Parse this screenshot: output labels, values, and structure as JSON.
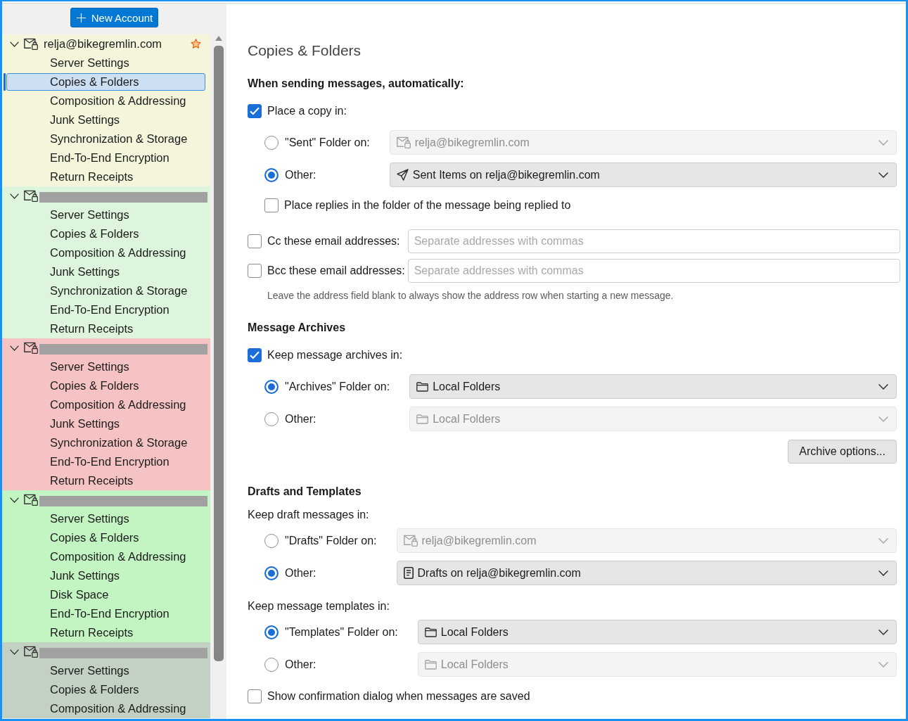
{
  "sidebar": {
    "new_account_button": {
      "label": "New Account"
    },
    "accounts": [
      {
        "name": "relja@bikegremlin.com",
        "redacted": false,
        "default": true,
        "expanded": true,
        "color": "#f5f5dc",
        "children": [
          {
            "label": "Server Settings",
            "selected": false
          },
          {
            "label": "Copies & Folders",
            "selected": true
          },
          {
            "label": "Composition & Addressing",
            "selected": false
          },
          {
            "label": "Junk Settings",
            "selected": false
          },
          {
            "label": "Synchronization & Storage",
            "selected": false
          },
          {
            "label": "End-To-End Encryption",
            "selected": false
          },
          {
            "label": "Return Receipts",
            "selected": false
          }
        ]
      },
      {
        "redacted": true,
        "default": false,
        "expanded": true,
        "color": "#dcf5dc",
        "children": [
          {
            "label": "Server Settings",
            "selected": false
          },
          {
            "label": "Copies & Folders",
            "selected": false
          },
          {
            "label": "Composition & Addressing",
            "selected": false
          },
          {
            "label": "Junk Settings",
            "selected": false
          },
          {
            "label": "Synchronization & Storage",
            "selected": false
          },
          {
            "label": "End-To-End Encryption",
            "selected": false
          },
          {
            "label": "Return Receipts",
            "selected": false
          }
        ]
      },
      {
        "redacted": true,
        "default": false,
        "expanded": true,
        "color": "#f5c3c3",
        "children": [
          {
            "label": "Server Settings",
            "selected": false
          },
          {
            "label": "Copies & Folders",
            "selected": false
          },
          {
            "label": "Composition & Addressing",
            "selected": false
          },
          {
            "label": "Junk Settings",
            "selected": false
          },
          {
            "label": "Synchronization & Storage",
            "selected": false
          },
          {
            "label": "End-To-End Encryption",
            "selected": false
          },
          {
            "label": "Return Receipts",
            "selected": false
          }
        ]
      },
      {
        "redacted": true,
        "default": false,
        "expanded": true,
        "color": "#c3f5c3",
        "children": [
          {
            "label": "Server Settings",
            "selected": false
          },
          {
            "label": "Copies & Folders",
            "selected": false
          },
          {
            "label": "Composition & Addressing",
            "selected": false
          },
          {
            "label": "Junk Settings",
            "selected": false
          },
          {
            "label": "Disk Space",
            "selected": false
          },
          {
            "label": "End-To-End Encryption",
            "selected": false
          },
          {
            "label": "Return Receipts",
            "selected": false
          }
        ]
      },
      {
        "redacted": true,
        "default": false,
        "expanded": true,
        "color": "#c3d1c3",
        "children": [
          {
            "label": "Server Settings",
            "selected": false
          },
          {
            "label": "Copies & Folders",
            "selected": false
          },
          {
            "label": "Composition & Addressing",
            "selected": false
          }
        ]
      }
    ]
  },
  "content": {
    "title": "Copies & Folders",
    "rows": [
      {
        "kind": "heading",
        "text": "When sending messages, automatically:"
      },
      {
        "kind": "checkbox",
        "label": "Place a copy in:",
        "checked": true,
        "children": [
          {
            "kind": "choice",
            "options": [
              {
                "label": "\"Sent\" Folder on:",
                "selected": false,
                "picker": {
                  "kind": "account",
                  "value": "relja@bikegremlin.com",
                  "disabled": true
                }
              },
              {
                "label": "Other:",
                "selected": true,
                "picker": {
                  "kind": "sent",
                  "value": "Sent Items on relja@bikegremlin.com",
                  "disabled": false
                }
              }
            ]
          },
          {
            "kind": "checkbox",
            "label": "Place replies in the folder of the message being replied to",
            "checked": false
          }
        ]
      },
      {
        "kind": "address_fields",
        "fields": [
          {
            "label": "Cc these email addresses:",
            "checked": false,
            "placeholder": "Separate addresses with commas"
          },
          {
            "label": "Bcc these email addresses:",
            "checked": false,
            "placeholder": "Separate addresses with commas"
          }
        ]
      },
      {
        "kind": "hint",
        "text": "Leave the address field blank to always show the address row when starting a new message."
      },
      {
        "kind": "heading",
        "text": "Message Archives"
      },
      {
        "kind": "checkbox",
        "label": "Keep message archives in:",
        "checked": true,
        "children": [
          {
            "kind": "choice",
            "options": [
              {
                "label": "\"Archives\" Folder on:",
                "selected": true,
                "picker": {
                  "kind": "folder",
                  "value": "Local Folders",
                  "disabled": false
                }
              },
              {
                "label": "Other:",
                "selected": false,
                "picker": {
                  "kind": "folder",
                  "value": "Local Folders",
                  "disabled": true
                }
              }
            ]
          }
        ]
      },
      {
        "kind": "button",
        "label": "Archive options..."
      },
      {
        "kind": "heading",
        "text": "Drafts and Templates"
      },
      {
        "kind": "label",
        "text": "Keep draft messages in:",
        "children": [
          {
            "kind": "choice",
            "options": [
              {
                "label": "\"Drafts\" Folder on:",
                "selected": false,
                "picker": {
                  "kind": "account",
                  "value": "relja@bikegremlin.com",
                  "disabled": true
                }
              },
              {
                "label": "Other:",
                "selected": true,
                "picker": {
                  "kind": "drafts",
                  "value": "Drafts on relja@bikegremlin.com",
                  "disabled": false
                }
              }
            ]
          }
        ]
      },
      {
        "kind": "label",
        "text": "Keep message templates in:",
        "children": [
          {
            "kind": "choice",
            "options": [
              {
                "label": "\"Templates\" Folder on:",
                "selected": true,
                "picker": {
                  "kind": "folder",
                  "value": "Local Folders",
                  "disabled": false
                }
              },
              {
                "label": "Other:",
                "selected": false,
                "picker": {
                  "kind": "folder",
                  "value": "Local Folders",
                  "disabled": true
                }
              }
            ]
          }
        ]
      },
      {
        "kind": "checkbox",
        "label": "Show confirmation dialog when messages are saved",
        "checked": false
      }
    ]
  }
}
